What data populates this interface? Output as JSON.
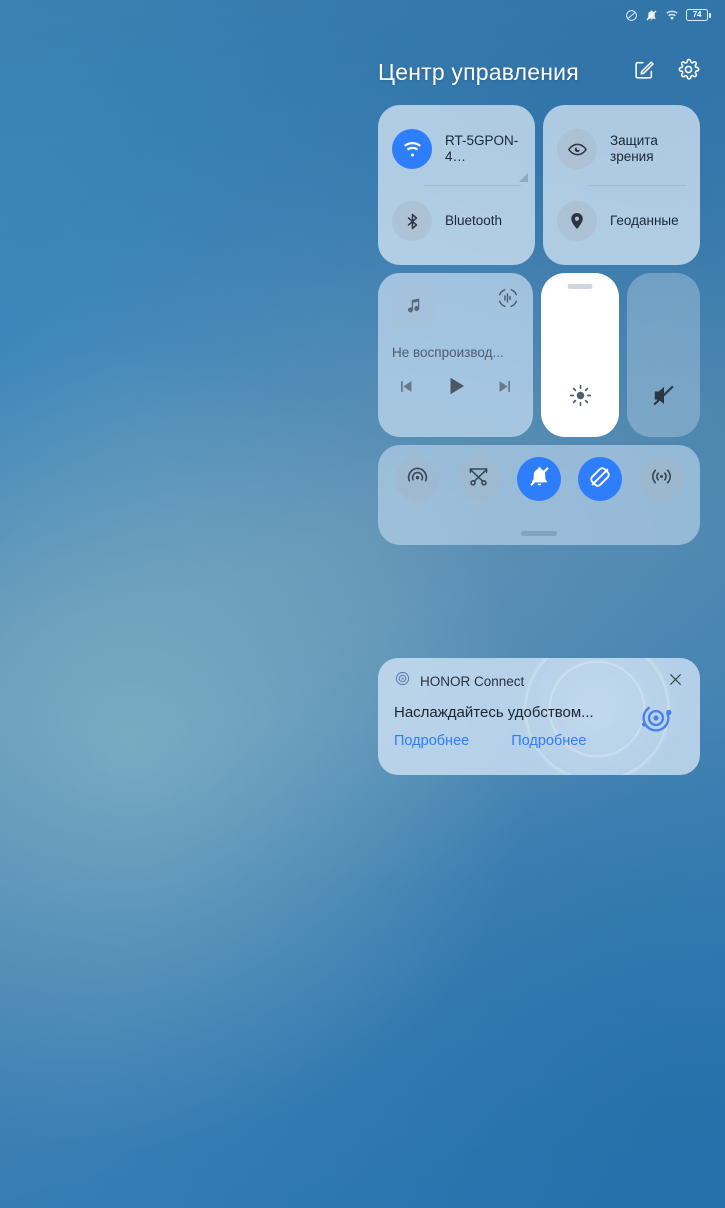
{
  "statusbar": {
    "icons": [
      "dnd-slash-icon",
      "bell-muted-icon",
      "wifi-icon"
    ],
    "battery_percent": "74"
  },
  "header": {
    "title": "Центр управления",
    "edit_icon": "edit-square-icon",
    "settings_icon": "gear-icon"
  },
  "toggles": {
    "left_card": [
      {
        "label": "RT-5GPON-4…",
        "icon": "wifi-icon",
        "active": true,
        "has_expand_arrow": true
      },
      {
        "label": "Bluetooth",
        "icon": "bluetooth-icon",
        "active": false
      }
    ],
    "right_card": [
      {
        "label": "Защита зрения",
        "icon": "eye-comfort-icon",
        "active": false
      },
      {
        "label": "Геоданные",
        "icon": "location-pin-icon",
        "active": false
      }
    ]
  },
  "media": {
    "album_art_icon": "music-note-icon",
    "cast_icon": "audio-output-icon",
    "title": "Не воспроизвод...",
    "controls": {
      "previous": "skip-previous-icon",
      "play": "play-icon",
      "next": "skip-next-icon"
    }
  },
  "sliders": {
    "brightness": {
      "icon": "brightness-sun-icon",
      "level_percent": 100
    },
    "volume": {
      "icon": "volume-muted-icon",
      "level_percent": 0
    }
  },
  "quick_toggles": [
    {
      "name": "screencast",
      "icon": "cast-icon",
      "active": false
    },
    {
      "name": "screenshot",
      "icon": "scissors-screenshot-icon",
      "active": false
    },
    {
      "name": "silent-mode",
      "icon": "bell-muted-icon",
      "active": true
    },
    {
      "name": "rotation-lock",
      "icon": "rotation-lock-icon",
      "active": true
    },
    {
      "name": "nfc",
      "icon": "nfc-icon",
      "active": false
    }
  ],
  "connect_card": {
    "app_icon": "honor-connect-icon",
    "app_name": "HONOR Connect",
    "close_icon": "close-icon",
    "message": "Наслаждайтесь удобством...",
    "actions": [
      "Подробнее",
      "Подробнее"
    ],
    "logo_icon": "honor-connect-logo-icon"
  },
  "colors": {
    "accent_blue": "#2e7dfb",
    "link_blue": "#2e7dfb",
    "panel_bg": "#cde2f5",
    "text_dark": "#1d2733"
  }
}
